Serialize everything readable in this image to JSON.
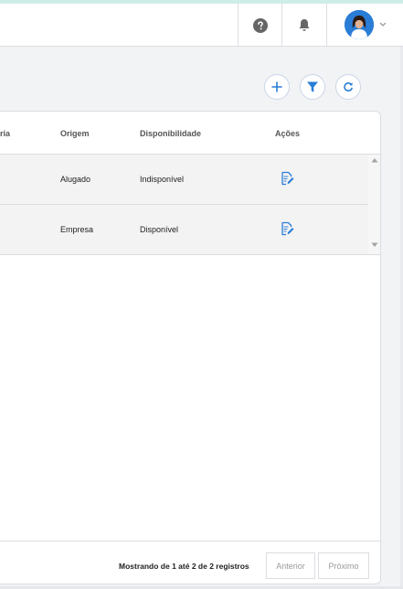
{
  "header": {
    "help_icon": "question-circle-icon",
    "notifications_icon": "bell-icon",
    "user_menu_icon": "chevron-down-icon"
  },
  "toolbar": {
    "add_icon": "plus-icon",
    "filter_icon": "filter-icon",
    "refresh_icon": "refresh-icon",
    "accent_color": "#2a7dd6"
  },
  "table": {
    "columns": {
      "partial": "ria",
      "origem": "Origem",
      "disponibilidade": "Disponibilidade",
      "acoes": "Ações"
    },
    "rows": [
      {
        "origem": "Alugado",
        "disponibilidade": "Indisponível",
        "action_icon": "edit-icon"
      },
      {
        "origem": "Empresa",
        "disponibilidade": "Disponível",
        "action_icon": "edit-icon"
      }
    ]
  },
  "pagination": {
    "info": "Mostrando de 1 até 2 de 2 registros",
    "previous_label": "Anterior",
    "next_label": "Próximo"
  }
}
